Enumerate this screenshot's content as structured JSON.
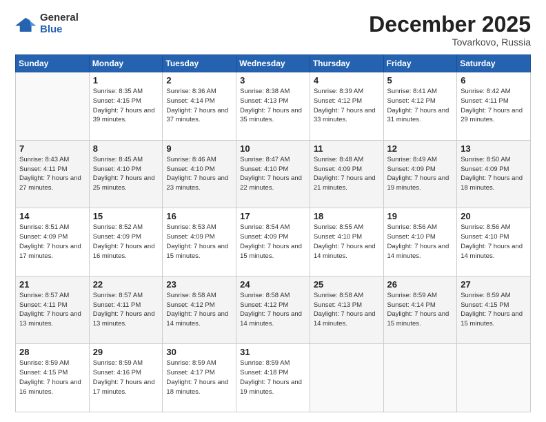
{
  "logo": {
    "general": "General",
    "blue": "Blue"
  },
  "title": "December 2025",
  "location": "Tovarkovo, Russia",
  "weekdays": [
    "Sunday",
    "Monday",
    "Tuesday",
    "Wednesday",
    "Thursday",
    "Friday",
    "Saturday"
  ],
  "weeks": [
    [
      {
        "day": "",
        "empty": true
      },
      {
        "day": "1",
        "sunrise": "Sunrise: 8:35 AM",
        "sunset": "Sunset: 4:15 PM",
        "daylight": "Daylight: 7 hours and 39 minutes."
      },
      {
        "day": "2",
        "sunrise": "Sunrise: 8:36 AM",
        "sunset": "Sunset: 4:14 PM",
        "daylight": "Daylight: 7 hours and 37 minutes."
      },
      {
        "day": "3",
        "sunrise": "Sunrise: 8:38 AM",
        "sunset": "Sunset: 4:13 PM",
        "daylight": "Daylight: 7 hours and 35 minutes."
      },
      {
        "day": "4",
        "sunrise": "Sunrise: 8:39 AM",
        "sunset": "Sunset: 4:12 PM",
        "daylight": "Daylight: 7 hours and 33 minutes."
      },
      {
        "day": "5",
        "sunrise": "Sunrise: 8:41 AM",
        "sunset": "Sunset: 4:12 PM",
        "daylight": "Daylight: 7 hours and 31 minutes."
      },
      {
        "day": "6",
        "sunrise": "Sunrise: 8:42 AM",
        "sunset": "Sunset: 4:11 PM",
        "daylight": "Daylight: 7 hours and 29 minutes."
      }
    ],
    [
      {
        "day": "7",
        "sunrise": "Sunrise: 8:43 AM",
        "sunset": "Sunset: 4:11 PM",
        "daylight": "Daylight: 7 hours and 27 minutes."
      },
      {
        "day": "8",
        "sunrise": "Sunrise: 8:45 AM",
        "sunset": "Sunset: 4:10 PM",
        "daylight": "Daylight: 7 hours and 25 minutes."
      },
      {
        "day": "9",
        "sunrise": "Sunrise: 8:46 AM",
        "sunset": "Sunset: 4:10 PM",
        "daylight": "Daylight: 7 hours and 23 minutes."
      },
      {
        "day": "10",
        "sunrise": "Sunrise: 8:47 AM",
        "sunset": "Sunset: 4:10 PM",
        "daylight": "Daylight: 7 hours and 22 minutes."
      },
      {
        "day": "11",
        "sunrise": "Sunrise: 8:48 AM",
        "sunset": "Sunset: 4:09 PM",
        "daylight": "Daylight: 7 hours and 21 minutes."
      },
      {
        "day": "12",
        "sunrise": "Sunrise: 8:49 AM",
        "sunset": "Sunset: 4:09 PM",
        "daylight": "Daylight: 7 hours and 19 minutes."
      },
      {
        "day": "13",
        "sunrise": "Sunrise: 8:50 AM",
        "sunset": "Sunset: 4:09 PM",
        "daylight": "Daylight: 7 hours and 18 minutes."
      }
    ],
    [
      {
        "day": "14",
        "sunrise": "Sunrise: 8:51 AM",
        "sunset": "Sunset: 4:09 PM",
        "daylight": "Daylight: 7 hours and 17 minutes."
      },
      {
        "day": "15",
        "sunrise": "Sunrise: 8:52 AM",
        "sunset": "Sunset: 4:09 PM",
        "daylight": "Daylight: 7 hours and 16 minutes."
      },
      {
        "day": "16",
        "sunrise": "Sunrise: 8:53 AM",
        "sunset": "Sunset: 4:09 PM",
        "daylight": "Daylight: 7 hours and 15 minutes."
      },
      {
        "day": "17",
        "sunrise": "Sunrise: 8:54 AM",
        "sunset": "Sunset: 4:09 PM",
        "daylight": "Daylight: 7 hours and 15 minutes."
      },
      {
        "day": "18",
        "sunrise": "Sunrise: 8:55 AM",
        "sunset": "Sunset: 4:10 PM",
        "daylight": "Daylight: 7 hours and 14 minutes."
      },
      {
        "day": "19",
        "sunrise": "Sunrise: 8:56 AM",
        "sunset": "Sunset: 4:10 PM",
        "daylight": "Daylight: 7 hours and 14 minutes."
      },
      {
        "day": "20",
        "sunrise": "Sunrise: 8:56 AM",
        "sunset": "Sunset: 4:10 PM",
        "daylight": "Daylight: 7 hours and 14 minutes."
      }
    ],
    [
      {
        "day": "21",
        "sunrise": "Sunrise: 8:57 AM",
        "sunset": "Sunset: 4:11 PM",
        "daylight": "Daylight: 7 hours and 13 minutes."
      },
      {
        "day": "22",
        "sunrise": "Sunrise: 8:57 AM",
        "sunset": "Sunset: 4:11 PM",
        "daylight": "Daylight: 7 hours and 13 minutes."
      },
      {
        "day": "23",
        "sunrise": "Sunrise: 8:58 AM",
        "sunset": "Sunset: 4:12 PM",
        "daylight": "Daylight: 7 hours and 14 minutes."
      },
      {
        "day": "24",
        "sunrise": "Sunrise: 8:58 AM",
        "sunset": "Sunset: 4:12 PM",
        "daylight": "Daylight: 7 hours and 14 minutes."
      },
      {
        "day": "25",
        "sunrise": "Sunrise: 8:58 AM",
        "sunset": "Sunset: 4:13 PM",
        "daylight": "Daylight: 7 hours and 14 minutes."
      },
      {
        "day": "26",
        "sunrise": "Sunrise: 8:59 AM",
        "sunset": "Sunset: 4:14 PM",
        "daylight": "Daylight: 7 hours and 15 minutes."
      },
      {
        "day": "27",
        "sunrise": "Sunrise: 8:59 AM",
        "sunset": "Sunset: 4:15 PM",
        "daylight": "Daylight: 7 hours and 15 minutes."
      }
    ],
    [
      {
        "day": "28",
        "sunrise": "Sunrise: 8:59 AM",
        "sunset": "Sunset: 4:15 PM",
        "daylight": "Daylight: 7 hours and 16 minutes."
      },
      {
        "day": "29",
        "sunrise": "Sunrise: 8:59 AM",
        "sunset": "Sunset: 4:16 PM",
        "daylight": "Daylight: 7 hours and 17 minutes."
      },
      {
        "day": "30",
        "sunrise": "Sunrise: 8:59 AM",
        "sunset": "Sunset: 4:17 PM",
        "daylight": "Daylight: 7 hours and 18 minutes."
      },
      {
        "day": "31",
        "sunrise": "Sunrise: 8:59 AM",
        "sunset": "Sunset: 4:18 PM",
        "daylight": "Daylight: 7 hours and 19 minutes."
      },
      {
        "day": "",
        "empty": true
      },
      {
        "day": "",
        "empty": true
      },
      {
        "day": "",
        "empty": true
      }
    ]
  ]
}
